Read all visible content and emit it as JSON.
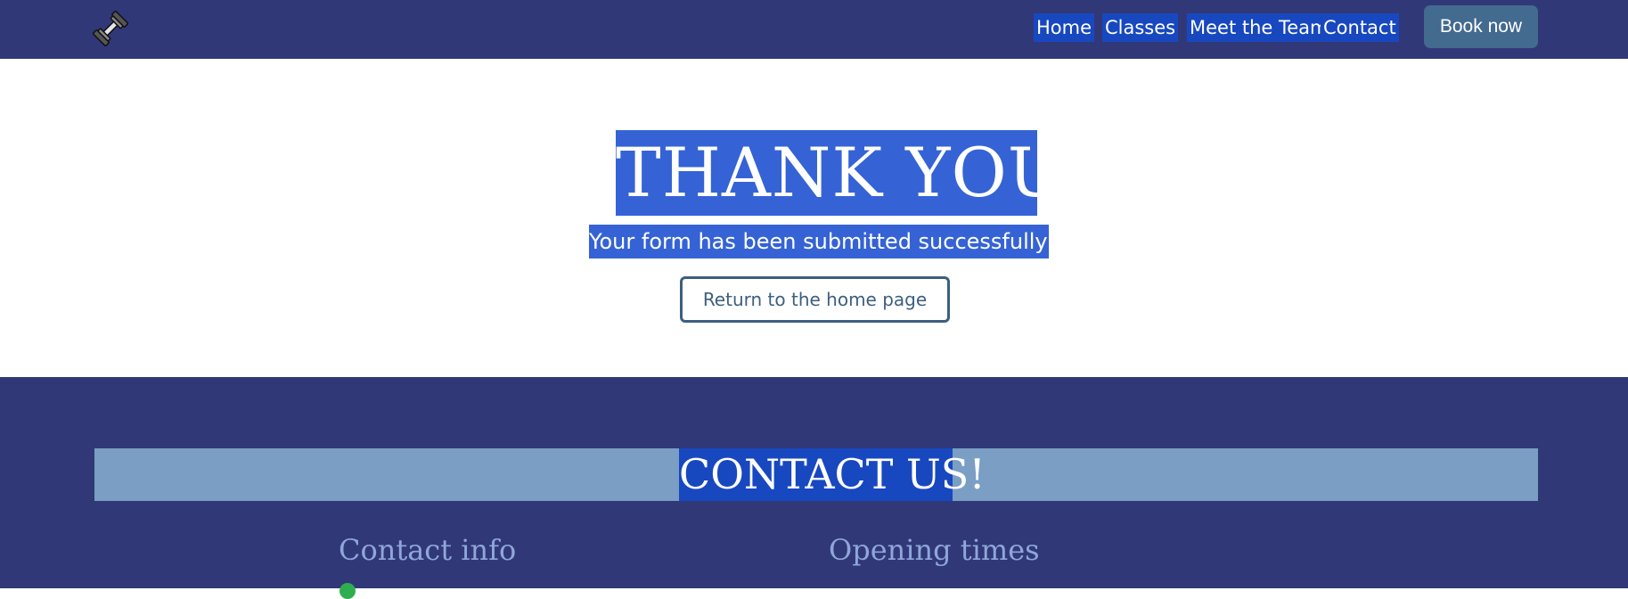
{
  "navbar": {
    "logo_icon": "dumbbell-icon",
    "links": [
      {
        "label": "Home"
      },
      {
        "label": "Classes"
      },
      {
        "label": "Meet the Team"
      },
      {
        "label": "Contact"
      }
    ],
    "book_label": "Book now"
  },
  "main": {
    "title": "THANK YOU!",
    "message": "Your form has been submitted successfully!",
    "return_label": "Return to the home page"
  },
  "footer": {
    "contact_title": "CONTACT US!",
    "contact_info_heading": "Contact info",
    "opening_times_heading": "Opening times"
  },
  "colors": {
    "navbar_bg": "#313878",
    "link_highlight": "#1848c0",
    "title_highlight": "#3563d6",
    "book_button": "#436a8f",
    "banner_bg": "#7b9ec4",
    "heading_text": "#8fa6d9"
  }
}
